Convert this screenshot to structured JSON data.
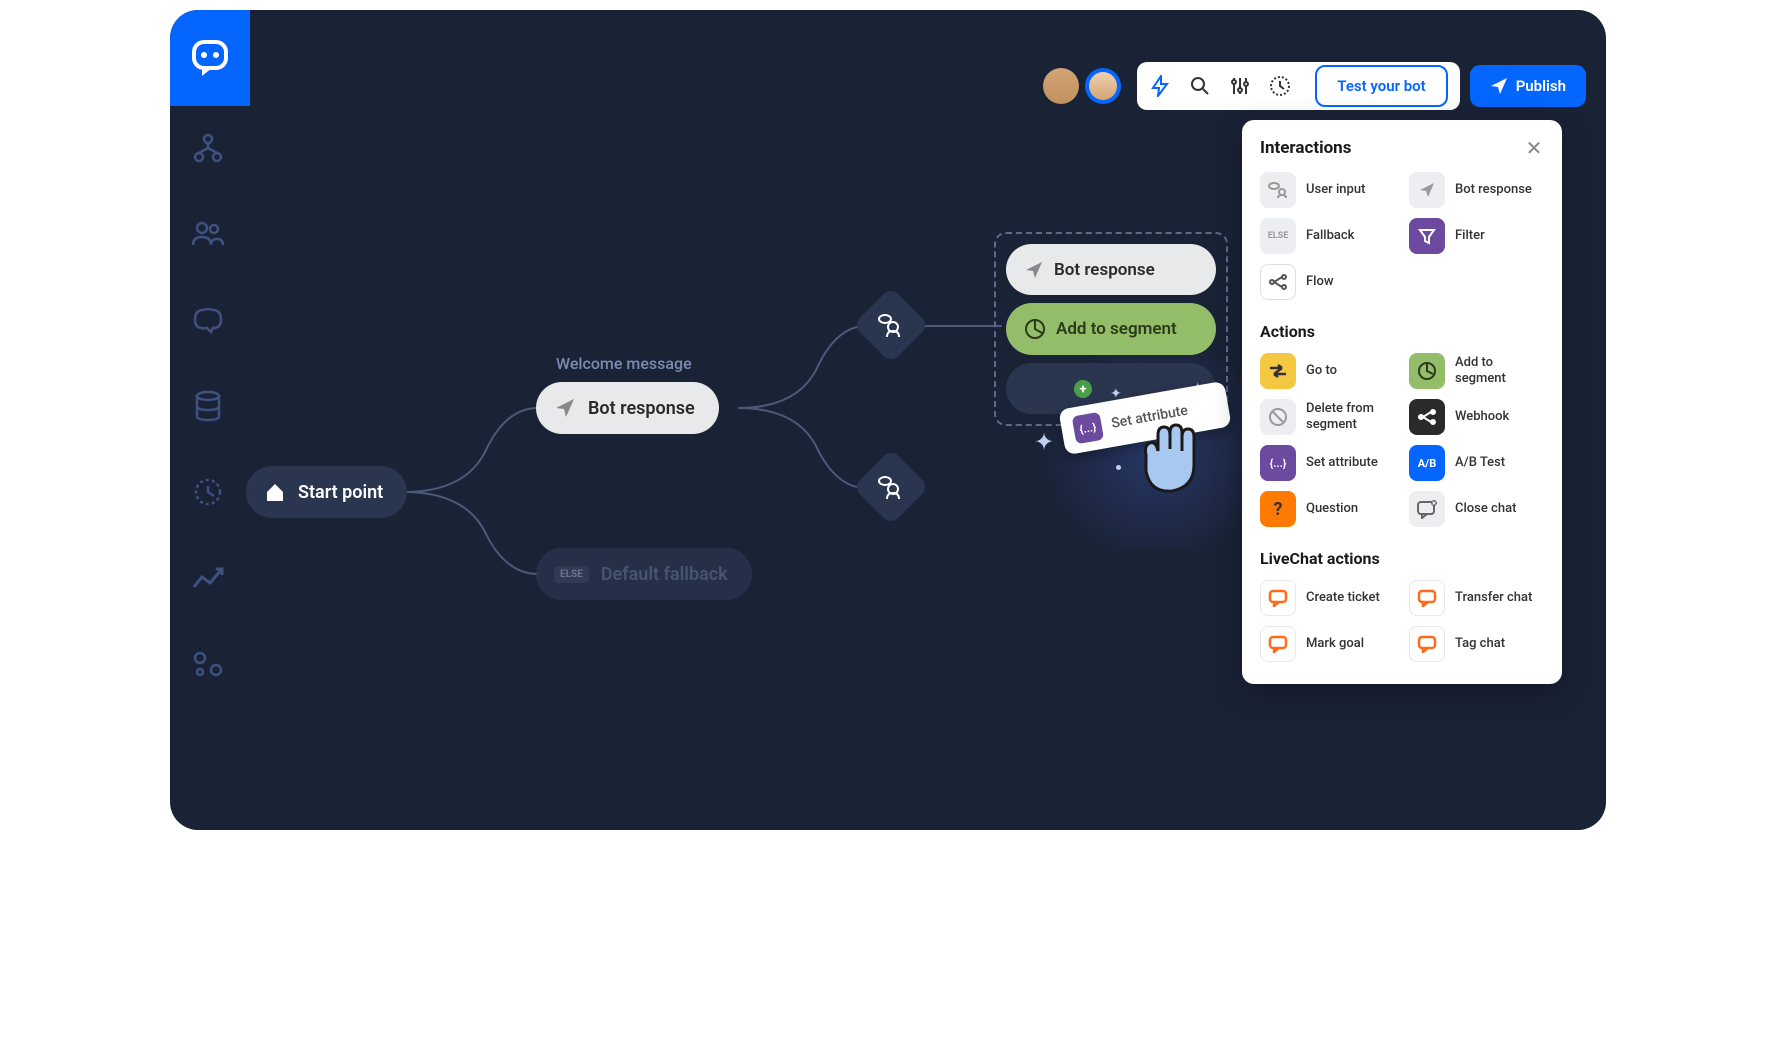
{
  "topbar": {
    "test_button": "Test your bot",
    "publish_button": "Publish"
  },
  "canvas": {
    "start_label": "Start point",
    "welcome_label": "Welcome message",
    "bot_response_label": "Bot response",
    "fallback_else": "ELSE",
    "fallback_label": "Default fallback",
    "drop_bot_response": "Bot response",
    "drop_segment": "Add to segment",
    "drag_card_label": "Set attribute",
    "drag_icon_text": "{...}"
  },
  "panel": {
    "section_interactions": "Interactions",
    "section_actions": "Actions",
    "section_livechat": "LiveChat actions",
    "items": {
      "user_input": "User input",
      "bot_response": "Bot response",
      "fallback": "Fallback",
      "fallback_badge": "ELSE",
      "filter": "Filter",
      "flow": "Flow",
      "goto": "Go to",
      "add_segment": "Add to segment",
      "delete_segment": "Delete from segment",
      "webhook": "Webhook",
      "set_attribute": "Set attribute",
      "ab_test": "A/B Test",
      "ab_badge": "A/B",
      "question": "Question",
      "close_chat": "Close chat",
      "create_ticket": "Create ticket",
      "transfer_chat": "Transfer chat",
      "mark_goal": "Mark goal",
      "tag_chat": "Tag chat"
    }
  }
}
